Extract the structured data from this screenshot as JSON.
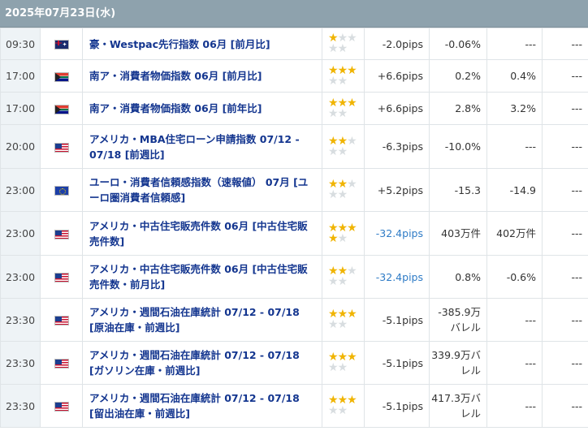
{
  "header": {
    "date": "2025年07月23日(水)"
  },
  "rows": [
    {
      "time": "09:30",
      "flag": "au-flag-icon",
      "name": "豪・Westpac先行指数 06月 [前月比]",
      "stars": 1,
      "pips": "-2.0pips",
      "pips_blue": false,
      "previous": "-0.06%",
      "forecast": "---",
      "result": "---"
    },
    {
      "time": "17:00",
      "flag": "za-flag-icon",
      "name": "南ア・消費者物価指数 06月 [前月比]",
      "stars": 3,
      "pips": "+6.6pips",
      "pips_blue": false,
      "previous": "0.2%",
      "forecast": "0.4%",
      "result": "---"
    },
    {
      "time": "17:00",
      "flag": "za-flag-icon",
      "name": "南ア・消費者物価指数 06月 [前年比]",
      "stars": 3,
      "pips": "+6.6pips",
      "pips_blue": false,
      "previous": "2.8%",
      "forecast": "3.2%",
      "result": "---"
    },
    {
      "time": "20:00",
      "flag": "us-flag-icon",
      "name": "アメリカ・MBA住宅ローン申請指数 07/12 - 07/18 [前週比]",
      "stars": 2,
      "pips": "-6.3pips",
      "pips_blue": false,
      "previous": "-10.0%",
      "forecast": "---",
      "result": "---"
    },
    {
      "time": "23:00",
      "flag": "eu-flag-icon",
      "name": "ユーロ・消費者信頼感指数（速報値） 07月 [ユーロ圏消費者信頼感]",
      "stars": 2,
      "pips": "+5.2pips",
      "pips_blue": false,
      "previous": "-15.3",
      "forecast": "-14.9",
      "result": "---"
    },
    {
      "time": "23:00",
      "flag": "us-flag-icon",
      "name": "アメリカ・中古住宅販売件数 06月 [中古住宅販売件数]",
      "stars": 4,
      "pips": "-32.4pips",
      "pips_blue": true,
      "previous": "403万件",
      "forecast": "402万件",
      "result": "---"
    },
    {
      "time": "23:00",
      "flag": "us-flag-icon",
      "name": "アメリカ・中古住宅販売件数 06月 [中古住宅販売件数・前月比]",
      "stars": 2,
      "pips": "-32.4pips",
      "pips_blue": true,
      "previous": "0.8%",
      "forecast": "-0.6%",
      "result": "---"
    },
    {
      "time": "23:30",
      "flag": "us-flag-icon",
      "name": "アメリカ・週間石油在庫統計 07/12 - 07/18 [原油在庫・前週比]",
      "stars": 3,
      "pips": "-5.1pips",
      "pips_blue": false,
      "previous": "-385.9万バレル",
      "forecast": "---",
      "result": "---"
    },
    {
      "time": "23:30",
      "flag": "us-flag-icon",
      "name": "アメリカ・週間石油在庫統計 07/12 - 07/18 [ガソリン在庫・前週比]",
      "stars": 3,
      "pips": "-5.1pips",
      "pips_blue": false,
      "previous": "339.9万バレル",
      "forecast": "---",
      "result": "---"
    },
    {
      "time": "23:30",
      "flag": "us-flag-icon",
      "name": "アメリカ・週間石油在庫統計 07/12 - 07/18 [留出油在庫・前週比]",
      "stars": 3,
      "pips": "-5.1pips",
      "pips_blue": false,
      "previous": "417.3万バレル",
      "forecast": "---",
      "result": "---"
    }
  ]
}
